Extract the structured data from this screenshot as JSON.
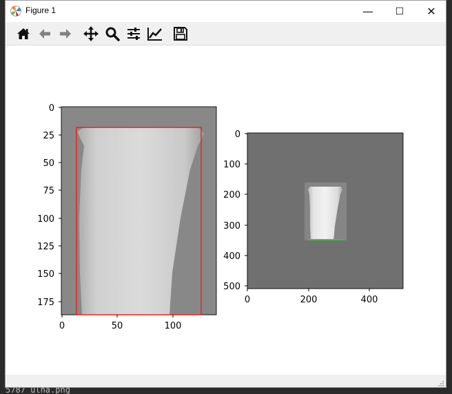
{
  "window": {
    "title": "Figure 1",
    "controls": {
      "minimize": "—",
      "maximize": "☐",
      "close": "✕"
    }
  },
  "toolbar": {
    "buttons": [
      {
        "name": "home-icon",
        "tooltip": "Home"
      },
      {
        "name": "back-arrow-icon",
        "tooltip": "Back"
      },
      {
        "name": "forward-arrow-icon",
        "tooltip": "Forward"
      },
      {
        "name": "pan-icon",
        "tooltip": "Pan"
      },
      {
        "name": "zoom-icon",
        "tooltip": "Zoom"
      },
      {
        "name": "subplots-icon",
        "tooltip": "Configure subplots"
      },
      {
        "name": "edit-curve-icon",
        "tooltip": "Edit axis"
      },
      {
        "name": "save-icon",
        "tooltip": "Save"
      }
    ]
  },
  "background": {
    "bottom_text": "5787 ulna.png"
  },
  "plots": {
    "left": {
      "xticks": [
        "0",
        "50",
        "100"
      ],
      "yticks": [
        "0",
        "25",
        "50",
        "75",
        "100",
        "125",
        "150",
        "175"
      ],
      "box_color": "#e8231f"
    },
    "right": {
      "xticks": [
        "0",
        "200",
        "400"
      ],
      "yticks": [
        "0",
        "100",
        "200",
        "300",
        "400",
        "500"
      ],
      "bg_color": "#707070",
      "line_color": "#39c93a"
    }
  }
}
